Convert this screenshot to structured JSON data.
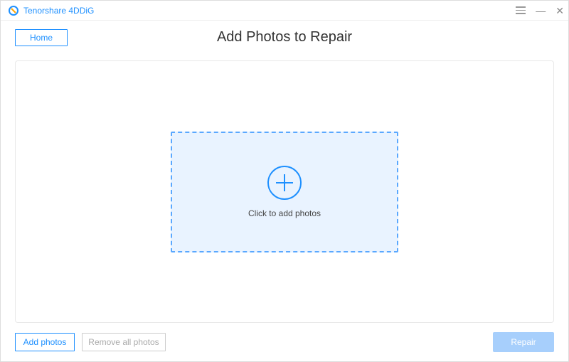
{
  "titlebar": {
    "app_name": "Tenorshare 4DDiG"
  },
  "header": {
    "home_label": "Home",
    "page_title": "Add Photos to Repair"
  },
  "dropzone": {
    "caption": "Click to add photos"
  },
  "footer": {
    "add_label": "Add photos",
    "remove_label": "Remove all photos",
    "repair_label": "Repair"
  }
}
